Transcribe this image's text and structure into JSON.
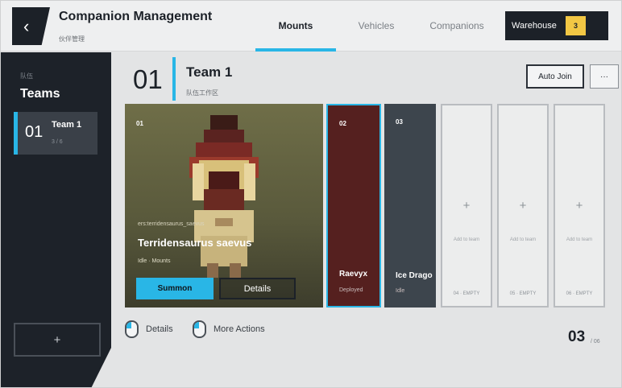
{
  "header": {
    "back_icon": "chevron-left-icon",
    "title": "Companion Management",
    "subtitle": "伙伴管理",
    "tabs": [
      {
        "label": "Mounts",
        "active": true
      },
      {
        "label": "Vehicles",
        "active": false
      },
      {
        "label": "Companions",
        "active": false
      }
    ],
    "warehouse": {
      "label": "Warehouse",
      "count": "3"
    }
  },
  "sidebar": {
    "small_label": "队伍",
    "title": "Teams",
    "items": [
      {
        "num": "01",
        "name": "Team 1",
        "count": "3 / 6"
      }
    ],
    "add_label": "+"
  },
  "team": {
    "num": "01",
    "title": "Team 1",
    "subtitle": "队伍工作区",
    "auto_join_label": "Auto Join",
    "more_label": "···"
  },
  "slots": {
    "main": {
      "num": "01",
      "tag": "ers:terridensaurus_saevus",
      "name": "Terridensaurus saevus",
      "meta": "Idle · Mounts",
      "summon_label": "Summon",
      "details_label": "Details"
    },
    "second": {
      "num": "02",
      "name": "Raevyx",
      "status": "Deployed"
    },
    "third": {
      "num": "03",
      "name": "Ice Drago",
      "status": "Idle"
    },
    "empty": [
      {
        "plus": "+",
        "add_label": "Add to team",
        "empty_label": "04 · EMPTY"
      },
      {
        "plus": "+",
        "add_label": "Add to team",
        "empty_label": "05 · EMPTY"
      },
      {
        "plus": "+",
        "add_label": "Add to team",
        "empty_label": "06 · EMPTY"
      }
    ]
  },
  "footer": {
    "hint_details": "Details",
    "hint_more": "More Actions",
    "page_current": "03",
    "page_total": "/ 06"
  },
  "colors": {
    "accent": "#29b6e6",
    "dark": "#1c2128",
    "badge": "#f2c744",
    "deployed": "#55201f"
  }
}
